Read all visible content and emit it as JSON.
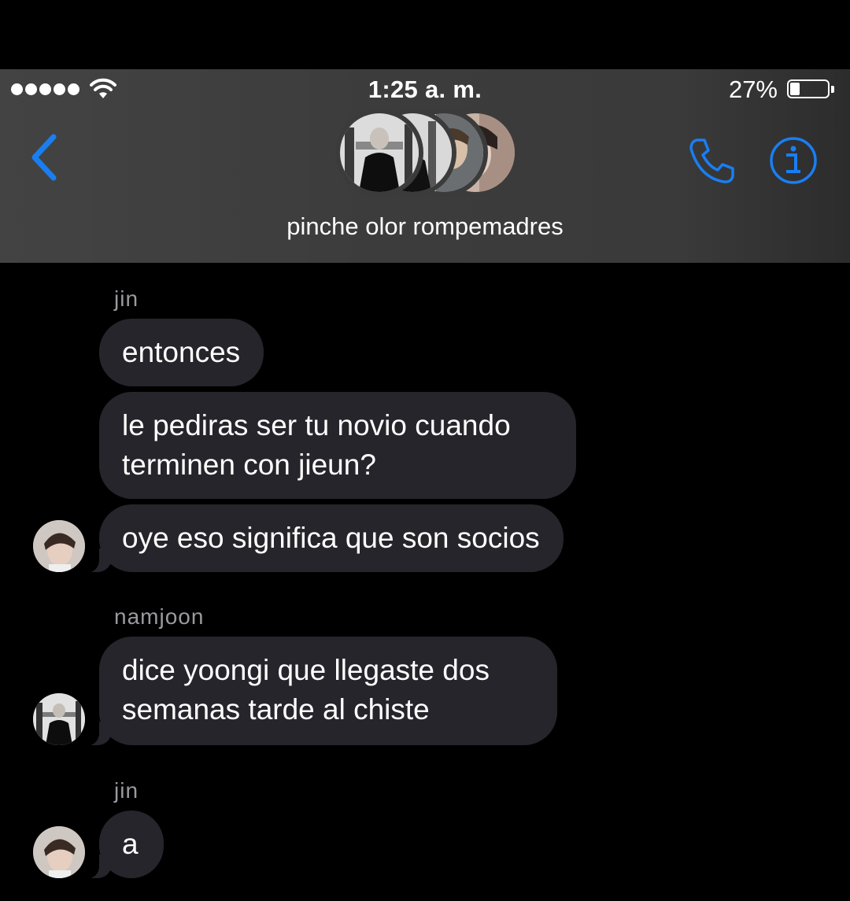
{
  "status_bar": {
    "time": "1:25 a. m.",
    "battery_percent": "27%",
    "battery_level": 0.27
  },
  "header": {
    "group_name": "pinche olor rompemadres",
    "accent_color": "#1a7ef2",
    "icons": [
      "back-chevron-icon",
      "phone-icon",
      "info-icon"
    ]
  },
  "messages": [
    {
      "sender": "jin",
      "texts": [
        "entonces",
        "le pediras ser tu novio cuando terminen con jieun?",
        "oye eso significa que son socios"
      ]
    },
    {
      "sender": "namjoon",
      "texts": [
        "dice yoongi que llegaste dos semanas tarde al chiste"
      ]
    },
    {
      "sender": "jin",
      "texts": [
        "a"
      ]
    }
  ]
}
